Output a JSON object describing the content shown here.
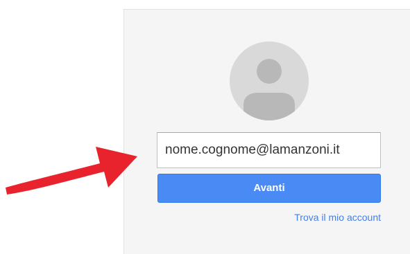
{
  "login": {
    "email_value": "nome.cognome@lamanzoni.it",
    "next_label": "Avanti",
    "find_account_label": "Trova il mio account"
  },
  "icons": {
    "avatar": "user-avatar-icon",
    "annotation": "red-arrow-icon"
  },
  "colors": {
    "accent": "#4a8af4",
    "link": "#427fed",
    "arrow": "#e8232d",
    "card_background": "#f5f5f5",
    "avatar_background": "#d9d9d9"
  }
}
